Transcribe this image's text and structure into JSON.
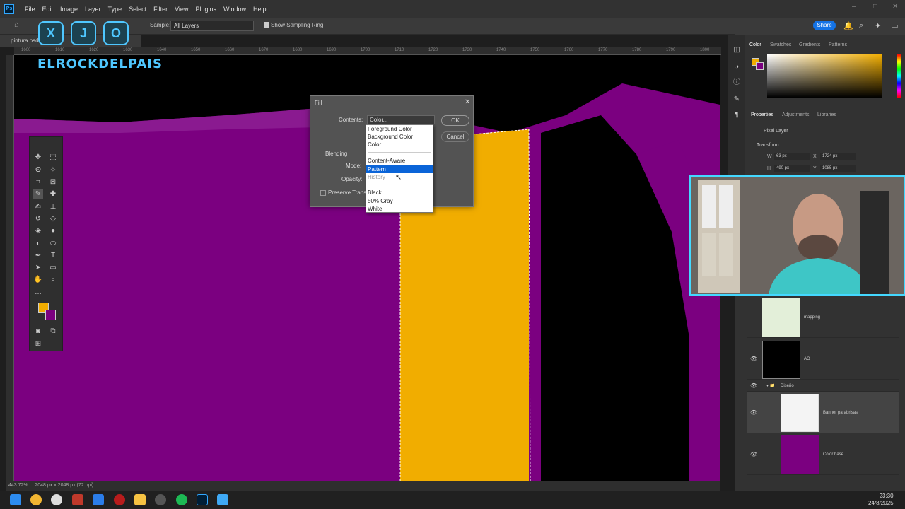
{
  "menubar": {
    "logo": "Ps",
    "items": [
      "File",
      "Edit",
      "Image",
      "Layer",
      "Type",
      "Select",
      "Filter",
      "View",
      "Plugins",
      "Window",
      "Help"
    ]
  },
  "options": {
    "sample_label": "Sample:",
    "sample_value": "All Layers",
    "sampling_ring_label": "Show Sampling Ring",
    "share_label": "Share"
  },
  "document": {
    "tab_title": "pintura.psd",
    "zoom": "443.72%",
    "doc_size": "2048 px x 2048 px (72 ppi)",
    "ruler_ticks": [
      "1600",
      "1610",
      "1620",
      "1630",
      "1640",
      "1650",
      "1660",
      "1670",
      "1680",
      "1690",
      "1700",
      "1710",
      "1720",
      "1730",
      "1740",
      "1750",
      "1760",
      "1770",
      "1780",
      "1790",
      "1800"
    ]
  },
  "overlay": {
    "social_icons": [
      "X",
      "J",
      "O"
    ],
    "brand": "ELROCKDELPAIS"
  },
  "dialog": {
    "title": "Fill",
    "contents_label": "Contents:",
    "contents_value": "Color...",
    "blending_label": "Blending",
    "mode_label": "Mode:",
    "opacity_label": "Opacity:",
    "preserve_label": "Preserve Trans",
    "ok_label": "OK",
    "cancel_label": "Cancel",
    "options": [
      "Foreground Color",
      "Background Color",
      "Color...",
      "Content-Aware",
      "Pattern",
      "History",
      "Black",
      "50% Gray",
      "White"
    ],
    "selected": "Pattern",
    "disabled": "History"
  },
  "panels": {
    "color_tabs": [
      "Color",
      "Swatches",
      "Gradients",
      "Patterns"
    ],
    "prop_tabs": [
      "Properties",
      "Adjustments",
      "Libraries"
    ],
    "pixel_layer": "Pixel Layer",
    "transform_label": "Transform",
    "w": "63 px",
    "x": "1724 px",
    "h": "490 px",
    "y": "1085 px"
  },
  "layers": [
    {
      "name": "mapping",
      "visible": false
    },
    {
      "name": "AO",
      "visible": true
    },
    {
      "name": "Diseño",
      "visible": true
    },
    {
      "name": "Banner parabrisas",
      "visible": true
    },
    {
      "name": "Color base",
      "visible": true
    }
  ],
  "taskbar": {
    "time": "23:30",
    "date": "24/8/2025"
  },
  "colors": {
    "purple": "#7b0080",
    "yellow": "#f1ad00",
    "accent": "#1473e6",
    "cam_border": "#44d8ff"
  }
}
